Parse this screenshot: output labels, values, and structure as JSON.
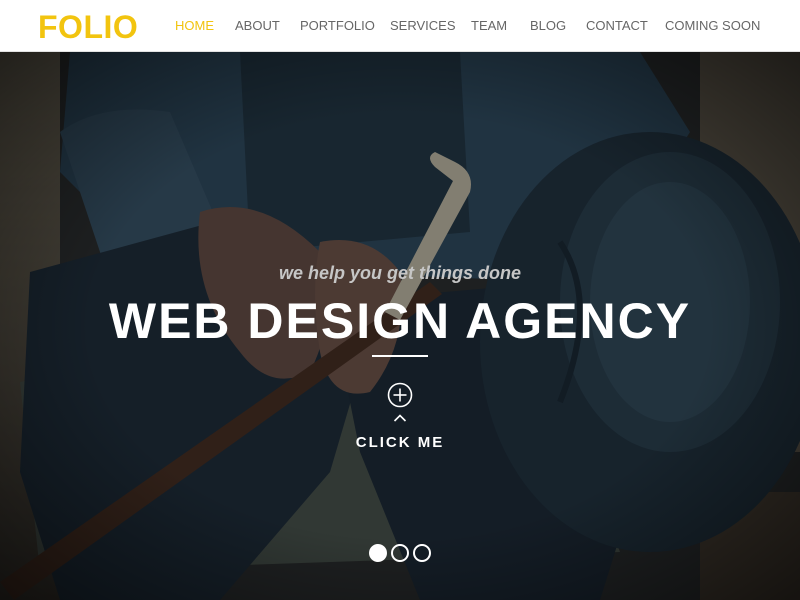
{
  "brand": {
    "logo_text": "FOLIO",
    "accent_color": "#f2c40f"
  },
  "nav": {
    "items": [
      {
        "label": "HOME",
        "active": true
      },
      {
        "label": "ABOUT",
        "active": false
      },
      {
        "label": "PORTFOLIO",
        "active": false
      },
      {
        "label": "SERVICES",
        "active": false
      },
      {
        "label": "TEAM",
        "active": false
      },
      {
        "label": "BLOG",
        "active": false
      },
      {
        "label": "CONTACT",
        "active": false
      },
      {
        "label": "COMING SOON",
        "active": false
      }
    ]
  },
  "hero": {
    "tagline": "we help you get things done",
    "headline": "WEB DESIGN AGENCY",
    "cta_label": "CLICK ME",
    "cta_icon": "plus-circle-icon",
    "scroll_icon": "chevron-up-icon",
    "background_image": "man-with-hat-and-cane-photo",
    "slider": {
      "total_slides": 3,
      "active_slide": 1
    }
  }
}
